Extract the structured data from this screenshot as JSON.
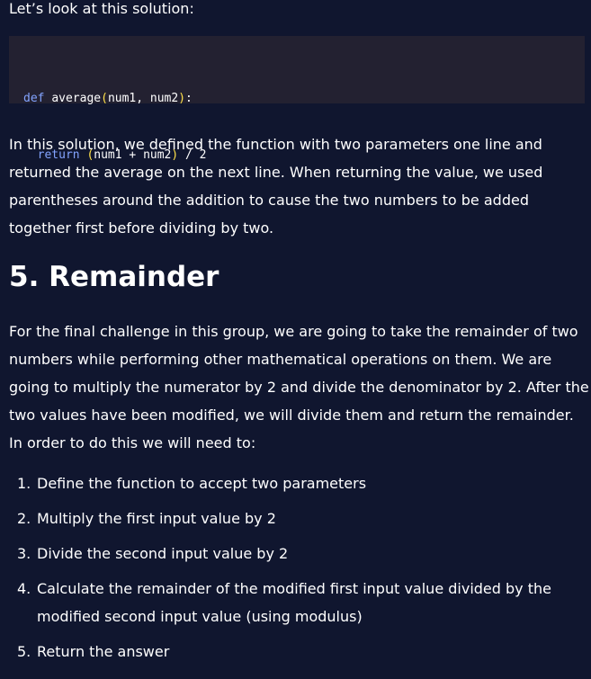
{
  "intro": "Let’s look at this solution:",
  "code": {
    "line1": {
      "keyword": "def",
      "name": "average",
      "open": "(",
      "params": "num1, num2",
      "close": ")",
      "colon": ":"
    },
    "line2": {
      "indent": "  ",
      "keyword": "return",
      "open": "(",
      "expr": "num1 + num2",
      "close": ")",
      "tail": " / 2"
    }
  },
  "explanation": "In this solution, we defined the function with two parameters one line and returned the average on the next line. When returning the value, we used parentheses around the addition to cause the two numbers to be added together first before dividing by two.",
  "section": {
    "heading": "5. Remainder",
    "body": "For the final challenge in this group, we are going to take the remainder of two numbers while performing other mathematical operations on them. We are going to multiply the numerator by 2 and divide the denominator by 2. After the two values have been modified, we will divide them and return the remainder. In order to do this we will need to:",
    "steps": [
      {
        "num": "1.",
        "text": "Define the function to accept two parameters"
      },
      {
        "num": "2.",
        "text": "Multiply the first input value by 2"
      },
      {
        "num": "3.",
        "text": "Divide the second input value by 2"
      },
      {
        "num": "4.",
        "text": "Calculate the remainder of the modified first input value divided by the modified second input value (using modulus)"
      },
      {
        "num": "5.",
        "text": "Return the answer"
      }
    ]
  },
  "colors": {
    "background": "#10162f",
    "code_background": "#232131",
    "keyword": "#83a4ff",
    "paren": "#ffe14a",
    "text": "#ffffff"
  }
}
